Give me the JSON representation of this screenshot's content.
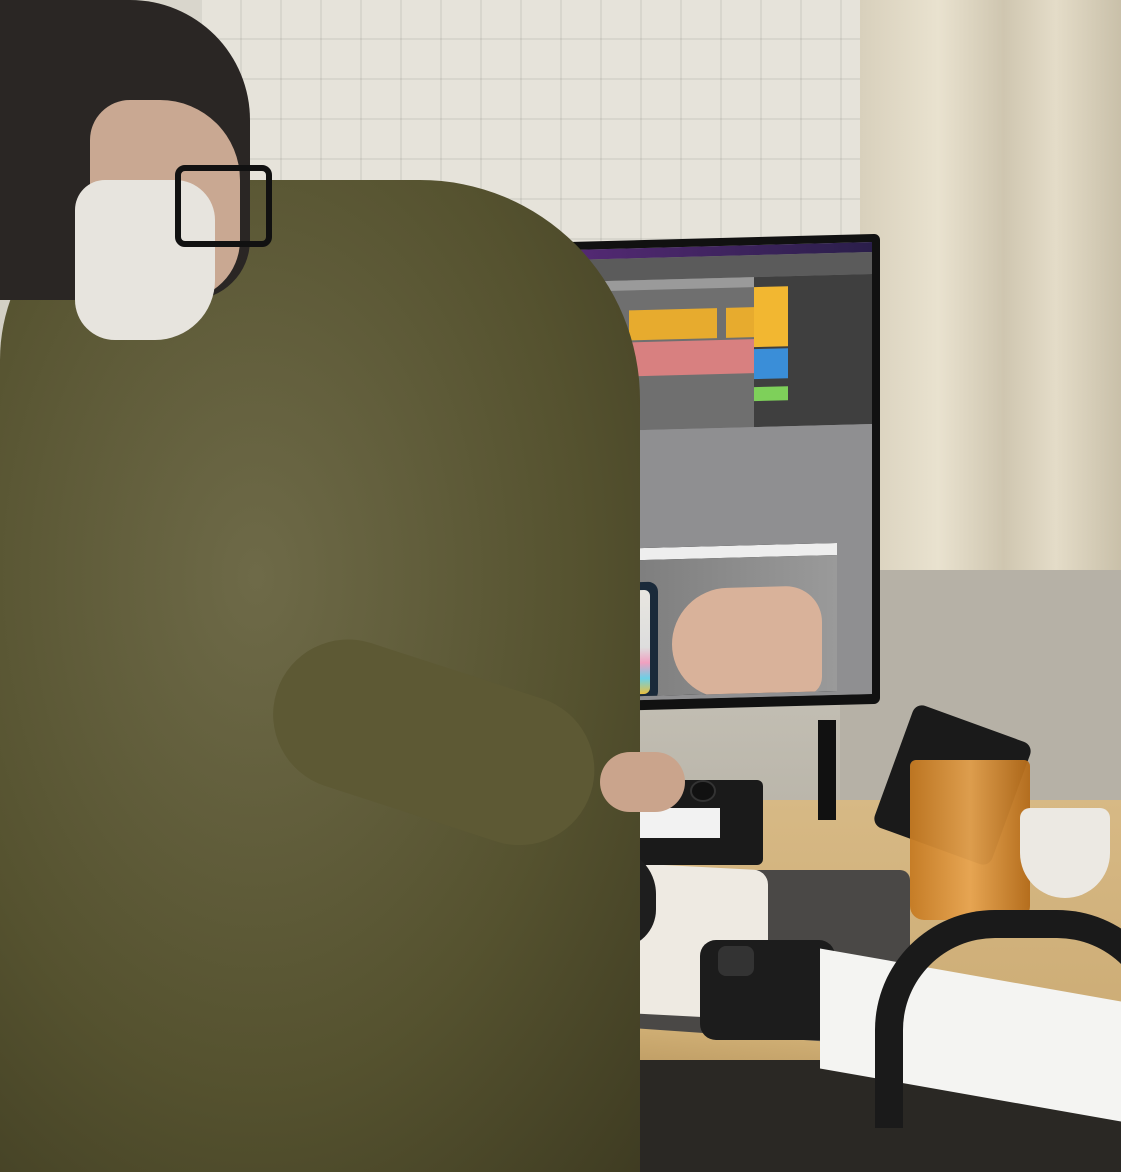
{
  "scene": {
    "description_tags": [
      "person",
      "monitor",
      "daw",
      "midi-keyboard",
      "mouse",
      "phone",
      "cup",
      "headphones"
    ]
  },
  "screen": {
    "app": "DAW",
    "colors": {
      "clip_purple": "#8d7ed4",
      "clip_red": "#d88080",
      "clip_yellow": "#e7ab2e",
      "mixer_blue": "#3a8ed8",
      "mixer_green": "#7ed05a"
    }
  }
}
